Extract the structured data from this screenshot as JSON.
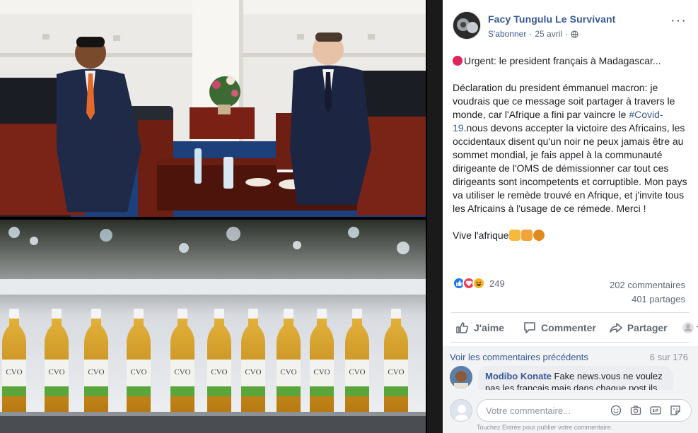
{
  "post": {
    "author": "Facy Tungulu Le Survivant",
    "follow": "S'abonner",
    "separator": "·",
    "date": "25 avril",
    "more": "···",
    "headline": "Urgent: le president français à Madagascar...",
    "body_before_hashtag": "Déclaration du president émmanuel macron: je voudrais que ce message soit partager à travers le monde, car l'Afrique a fini par vaincre le ",
    "hashtag": "#Covid-19",
    "body_after_hashtag": ".nous devons accepter la victoire des Africains, les occidentaux disent qu'un noir ne peux jamais être au sommet mondial, je fais appel à la communauté dirigeante de l'OMS de démissionner car tout ces dirigeants sont incompetents et corruptible. Mon pays va utiliser le remède trouvé en Afrique, et j'invite tous les Africains à l'usage de ce rémede. Merci !",
    "closing": "Vive l'afrique"
  },
  "stats": {
    "reactions_count": "249",
    "comments": "202 commentaires",
    "shares": "401 partages"
  },
  "actions": {
    "like": "J'aime",
    "comment": "Commenter",
    "share": "Partager"
  },
  "comments": {
    "previous": "Voir les commentaires précédents",
    "count": "6 sur 176",
    "first": {
      "author": "Modibo Konate",
      "text": "Fake news.vous ne voulez pas les français mais dans chaque post ils"
    },
    "composer": {
      "placeholder": "Votre commentaire...",
      "hint": "Touchez Entrée pour publier votre commentaire."
    }
  },
  "media": {
    "bottle_label": "CVO"
  },
  "icons": [
    "globe-icon",
    "more-icon",
    "like-icon",
    "comment-icon",
    "share-icon",
    "audience-icon",
    "emoji-icon",
    "camera-icon",
    "gif-icon",
    "sticker-icon"
  ],
  "colors": {
    "link": "#385898",
    "text": "#1c1e21",
    "muted": "#616770",
    "like_blue": "#1877f2",
    "love_red": "#f33e58",
    "haha_yellow": "#f7b125"
  }
}
